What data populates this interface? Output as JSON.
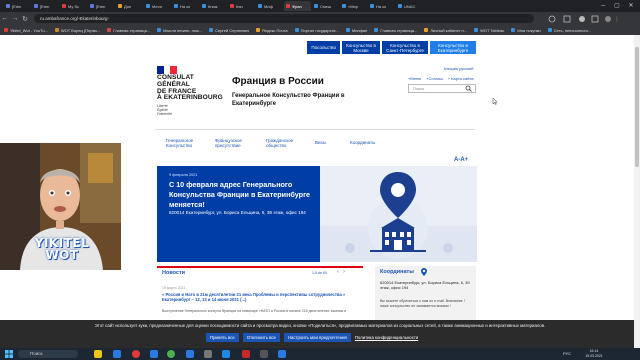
{
  "browser": {
    "tabs": [
      {
        "label": "[Edm",
        "color": "#5a7bd8"
      },
      {
        "label": "[Edm",
        "color": "#5a7bd8"
      },
      {
        "label": "My Sc",
        "color": "#e23a3a"
      },
      {
        "label": "[Edm",
        "color": "#5a7bd8"
      },
      {
        "label": "Доп",
        "color": "#e6a326"
      },
      {
        "label": "Меся",
        "color": "#3a8fd8"
      },
      {
        "label": "На ко",
        "color": "#3a8fd8"
      },
      {
        "label": "Книж",
        "color": "#3a8fd8"
      },
      {
        "label": "Кан",
        "color": "#e23a3a"
      },
      {
        "label": "Миф",
        "color": "#3a8fd8"
      },
      {
        "label": "Фран",
        "color": "#e23a3a",
        "active": true
      },
      {
        "label": "Смеш",
        "color": "#3a8fd8"
      },
      {
        "label": "«Мир",
        "color": "#3a8fd8"
      },
      {
        "label": "На ко",
        "color": "#3a8fd8"
      },
      {
        "label": "UNAC",
        "color": "#3a8fd8"
      }
    ],
    "url": "ru.ambafrance.org/-Ekaterinbourg-",
    "bookmarks": [
      {
        "label": "Yikitel_Wot - YouTu...",
        "color": "#e23a3a"
      },
      {
        "label": "WOT Борец (Перво...",
        "color": "#c08a2e"
      },
      {
        "label": "Главная страница...",
        "color": "#d24848"
      },
      {
        "label": "Мысли печать, нож...",
        "color": "#3a8fd8"
      },
      {
        "label": "Сергей Сергеевич",
        "color": "#3a8fd8"
      },
      {
        "label": "Яндекс Почта",
        "color": "#e6a326"
      },
      {
        "label": "Портал государств...",
        "color": "#3a8fd8"
      },
      {
        "label": "Минфин",
        "color": "#3a8fd8"
      },
      {
        "label": "Главная страница...",
        "color": "#3a8fd8"
      },
      {
        "label": "Личный кабинет н...",
        "color": "#e6a326"
      },
      {
        "label": "WOT Tableau",
        "color": "#3a8fd8"
      },
      {
        "label": "Мои покупки",
        "color": "#3a8fd8"
      },
      {
        "label": "Сеть, пенсионного...",
        "color": "#3a8fd8"
      }
    ]
  },
  "site": {
    "top_nav": [
      "Посольство",
      "Консульство в Москве",
      "Консульство в Санкт-Петербурге",
      "Консульство в Екатеринбурге"
    ],
    "logo_text": "CONSULAT GÉNÉRAL DE FRANCE À EKATERINBOURG",
    "logo_lines": [
      "CONSULAT",
      "GÉNÉRAL",
      "DE FRANCE",
      "À EKATERINBOURG"
    ],
    "motto": [
      "Liberté",
      "Égalité",
      "Fraternité"
    ],
    "title": "Франция в России",
    "subtitle": "Генеральное Консульство Франции в Екатеринбурге",
    "language_link": "français русский",
    "utility_links": [
      "+Меню",
      "+Соглаш",
      "+ Карта сайта"
    ],
    "search_placeholder": "Поиск",
    "main_menu": [
      "Генеральное Консульство",
      "Французское присутствие",
      "Гражданское общество",
      "Визы",
      "Координаты"
    ],
    "a11y": "A-A+",
    "hero": {
      "date": "9 февраля 2021",
      "title": "С 10 февраля адрес Генерального Консульства Франции в Екатеринбурге меняется!",
      "address": "620014 Екатеринбург, ул. Бориса Ельцина, 6, 39 этаж, офис 194"
    },
    "news": {
      "title": "Новости",
      "count": "1-5 de 50",
      "date": "15 марта 2021",
      "item_title": "« Россия и Нато в 21м десятилетии 21 века Проблемы и перспективы сотрудничества » Екатеринбург – 12, 13 и 14 июня 2021 (...)",
      "item_text": "Выступление Генерального консула Франции на семинаре «НАТО и Россия в начале 21й десятилетия: вызовы и"
    },
    "contacts": {
      "title": "Координаты",
      "address": "620014 Екатеринбург, ул. Бориса Ельцина, 6, 39 этаж, офис 194",
      "note": "Вы можете обратиться к нам по e-mail. Внимание ! наше консульство не занимается визами !"
    }
  },
  "cookie": {
    "text": "Этот сайт использует куки, предназначенные для оценки посещаемости сайта и просмотра видео, кнопки «Поделиться», продвигаемых материалов из социальных сетей, а также анимационных и интерактивных материалов.",
    "accept": "Принять все",
    "reject": "Отклонить все",
    "settings": "Настроить мои предпочтения",
    "policy": "Политика конфиденциальности"
  },
  "cam": {
    "watermark_line1": "YIKITEL",
    "watermark_line2": "WOT"
  },
  "taskbar": {
    "search": "Поиск",
    "lang": "РУС",
    "time": "16:14",
    "date": "19.03.2021"
  }
}
